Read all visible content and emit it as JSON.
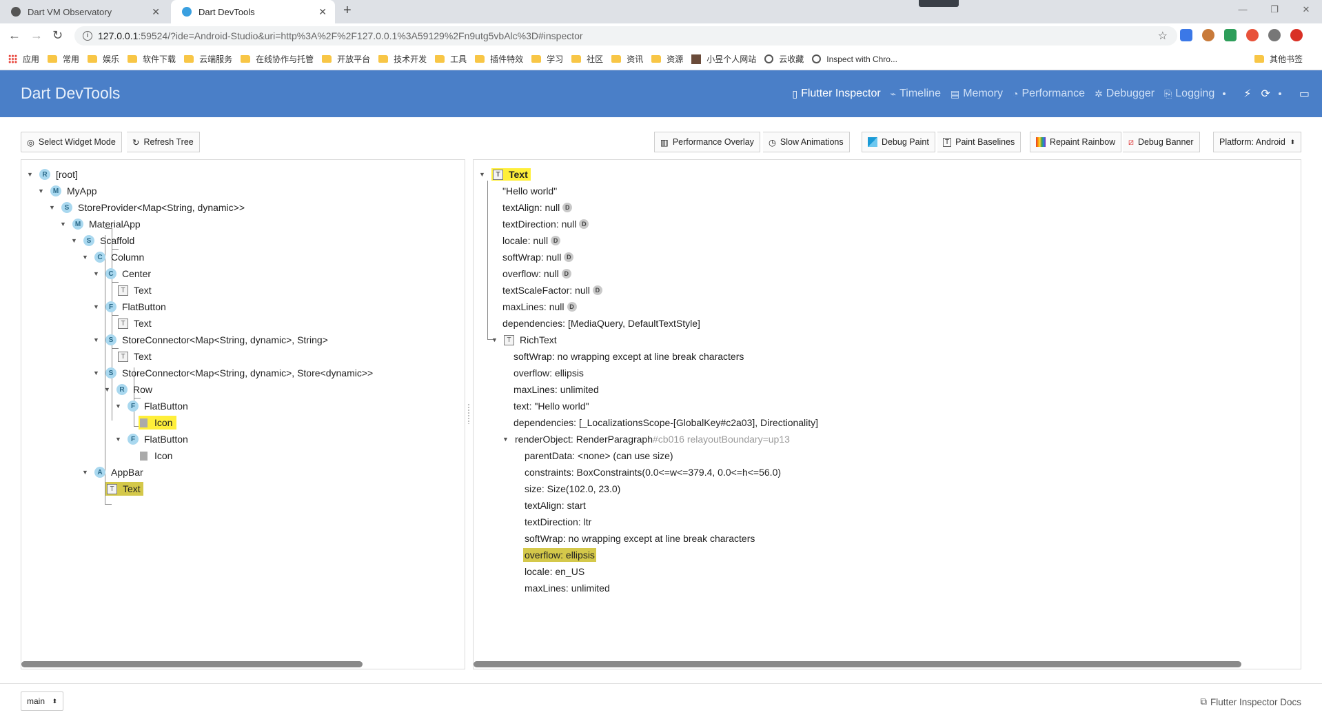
{
  "browser": {
    "tabs": [
      {
        "title": "Dart VM Observatory",
        "active": false
      },
      {
        "title": "Dart DevTools",
        "active": true
      }
    ],
    "new_tab_glyph": "+",
    "window_controls": [
      "—",
      "❐",
      "✕"
    ],
    "url_host": "127.0.0.1",
    "url_rest": ":59524/?ide=Android-Studio&uri=http%3A%2F%2F127.0.0.1%3A59129%2Fn9utg5vbAlc%3D#inspector",
    "bookmarks": [
      "应用",
      "常用",
      "娱乐",
      "软件下载",
      "云端服务",
      "在线协作与托管",
      "开放平台",
      "技术开发",
      "工具",
      "插件特效",
      "学习",
      "社区",
      "资讯",
      "资源",
      "小昱个人网站",
      "云收藏",
      "Inspect with Chro..."
    ],
    "other_bookmarks": "其他书签"
  },
  "devtools": {
    "title": "Dart DevTools",
    "nav": [
      "Flutter Inspector",
      "Timeline",
      "Memory",
      "Performance",
      "Debugger",
      "Logging"
    ],
    "active_nav": "Flutter Inspector"
  },
  "toolbar": {
    "select_widget_mode": "Select Widget Mode",
    "refresh_tree": "Refresh Tree",
    "performance_overlay": "Performance Overlay",
    "slow_animations": "Slow Animations",
    "debug_paint": "Debug Paint",
    "paint_baselines": "Paint Baselines",
    "repaint_rainbow": "Repaint Rainbow",
    "debug_banner": "Debug Banner",
    "platform": "Platform: Android"
  },
  "tree": [
    {
      "badge": "R",
      "label": "[root]"
    },
    {
      "badge": "M",
      "label": "MyApp"
    },
    {
      "badge": "S",
      "label": "StoreProvider<Map<String, dynamic>>"
    },
    {
      "badge": "M",
      "label": "MaterialApp"
    },
    {
      "badge": "S",
      "label": "Scaffold"
    },
    {
      "badge": "C",
      "label": "Column"
    },
    {
      "badge": "C",
      "label": "Center"
    },
    {
      "badge": "T",
      "label": "Text"
    },
    {
      "badge": "F",
      "label": "FlatButton"
    },
    {
      "badge": "T",
      "label": "Text"
    },
    {
      "badge": "S",
      "label": "StoreConnector<Map<String, dynamic>, String>"
    },
    {
      "badge": "T",
      "label": "Text"
    },
    {
      "badge": "S",
      "label": "StoreConnector<Map<String, dynamic>, Store<dynamic>>"
    },
    {
      "badge": "R",
      "label": "Row"
    },
    {
      "badge": "F",
      "label": "FlatButton"
    },
    {
      "badge": "icon",
      "label": "Icon"
    },
    {
      "badge": "F",
      "label": "FlatButton"
    },
    {
      "badge": "icon",
      "label": "Icon"
    },
    {
      "badge": "A",
      "label": "AppBar"
    },
    {
      "badge": "T",
      "label": "Text"
    }
  ],
  "details": {
    "root_label": "Text",
    "lines": [
      {
        "text": "\"Hello world\"",
        "d": false
      },
      {
        "text": "textAlign: null",
        "d": true
      },
      {
        "text": "textDirection: null",
        "d": true
      },
      {
        "text": "locale: null",
        "d": true
      },
      {
        "text": "softWrap: null",
        "d": true
      },
      {
        "text": "overflow: null",
        "d": true
      },
      {
        "text": "textScaleFactor: null",
        "d": true
      },
      {
        "text": "maxLines: null",
        "d": true
      },
      {
        "text": "dependencies: [MediaQuery, DefaultTextStyle]",
        "d": false
      }
    ],
    "richtext_label": "RichText",
    "richtext_lines": [
      "softWrap: no wrapping except at line break characters",
      "overflow: ellipsis",
      "maxLines: unlimited",
      "text: \"Hello world\"",
      "dependencies: [_LocalizationsScope-[GlobalKey#c2a03], Directionality]"
    ],
    "render_object_label": "renderObject: RenderParagraph",
    "render_object_suffix": "#cb016 relayoutBoundary=up13",
    "render_lines": [
      "parentData: <none> (can use size)",
      "constraints: BoxConstraints(0.0<=w<=379.4, 0.0<=h<=56.0)",
      "size: Size(102.0, 23.0)",
      "textAlign: start",
      "textDirection: ltr",
      "softWrap: no wrapping except at line break characters",
      "overflow: ellipsis",
      "locale: en_US",
      "maxLines: unlimited"
    ],
    "d_badge": "D"
  },
  "footer": {
    "isolate": "main",
    "docs_link": "Flutter Inspector Docs"
  },
  "colors": {
    "appbar": "#4a7fc8",
    "selected_highlight": "#ffef3a",
    "secondary_highlight": "#d4c84a"
  }
}
